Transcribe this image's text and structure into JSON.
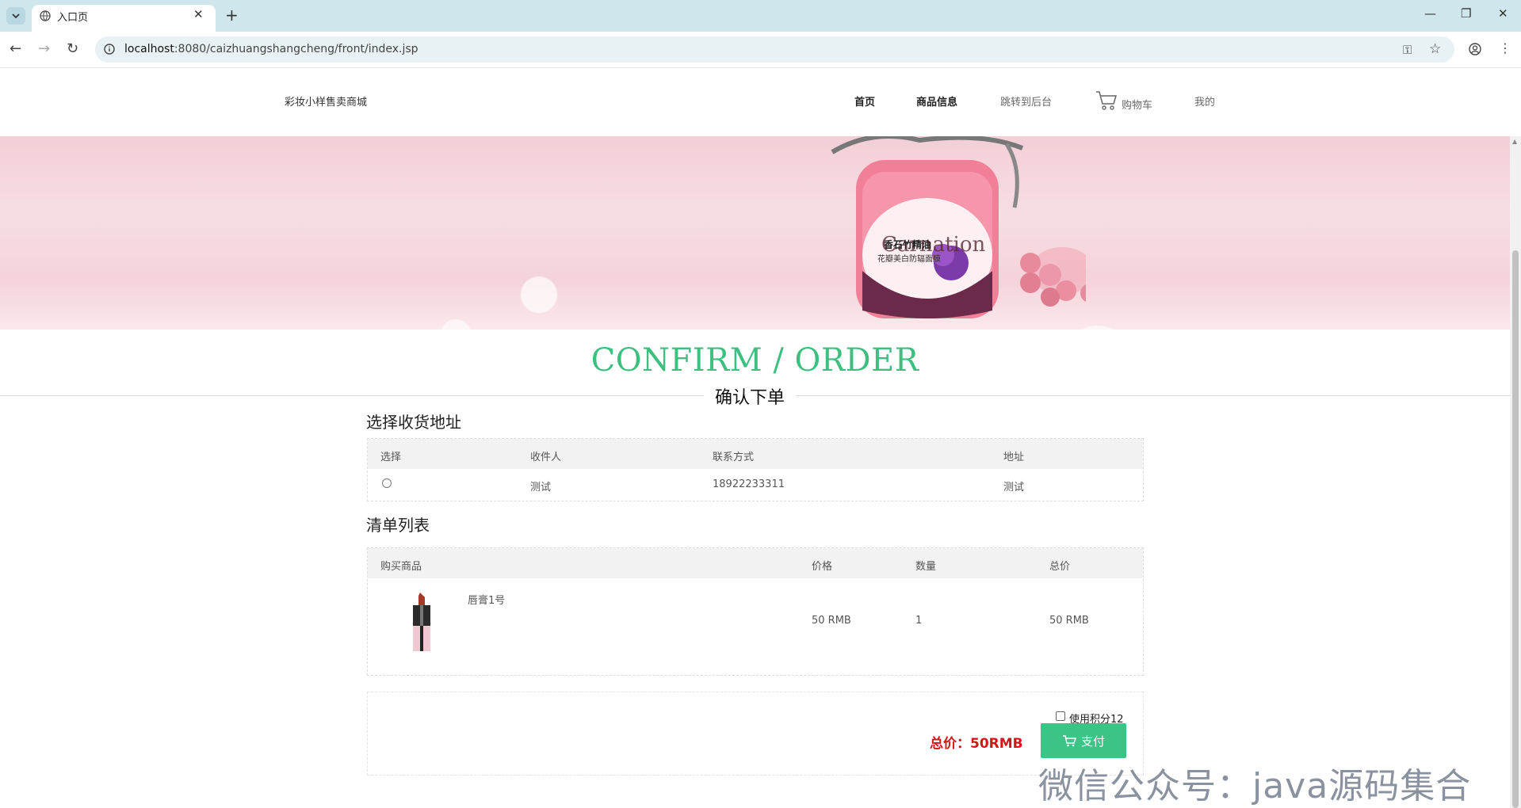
{
  "browser": {
    "tab_title": "入口页",
    "url_host": "localhost",
    "url_rest": ":8080/caizhuangshangcheng/front/index.jsp"
  },
  "site": {
    "brand": "彩妆小样售卖商城",
    "nav": {
      "home": "首页",
      "products": "商品信息",
      "admin": "跳转到后台",
      "cart": "购物车",
      "mine": "我的"
    }
  },
  "banner": {
    "product_text_1": "香石竹精油",
    "product_text_2": "花瓣美白防辐面膜",
    "product_brand": "Carnation"
  },
  "page": {
    "title_en": "CONFIRM / ORDER",
    "title_zh": "确认下单"
  },
  "address_section": {
    "title": "选择收货地址",
    "headers": [
      "选择",
      "收件人",
      "联系方式",
      "地址"
    ],
    "rows": [
      {
        "recipient": "测试",
        "phone": "18922233311",
        "address": "测试"
      }
    ]
  },
  "order_section": {
    "title": "清单列表",
    "headers": [
      "购买商品",
      "价格",
      "数量",
      "总价"
    ],
    "items": [
      {
        "name": "唇膏1号",
        "price": "50 RMB",
        "qty": "1",
        "total": "50 RMB"
      }
    ]
  },
  "checkout": {
    "points_label": "使用积分12",
    "total_label": "总价：50RMB",
    "pay_label": "支付"
  },
  "watermark": "微信公众号：java源码集合",
  "colors": {
    "accent": "#3cbf7f",
    "price_red": "#d01818",
    "pay_btn": "#3cc486"
  }
}
